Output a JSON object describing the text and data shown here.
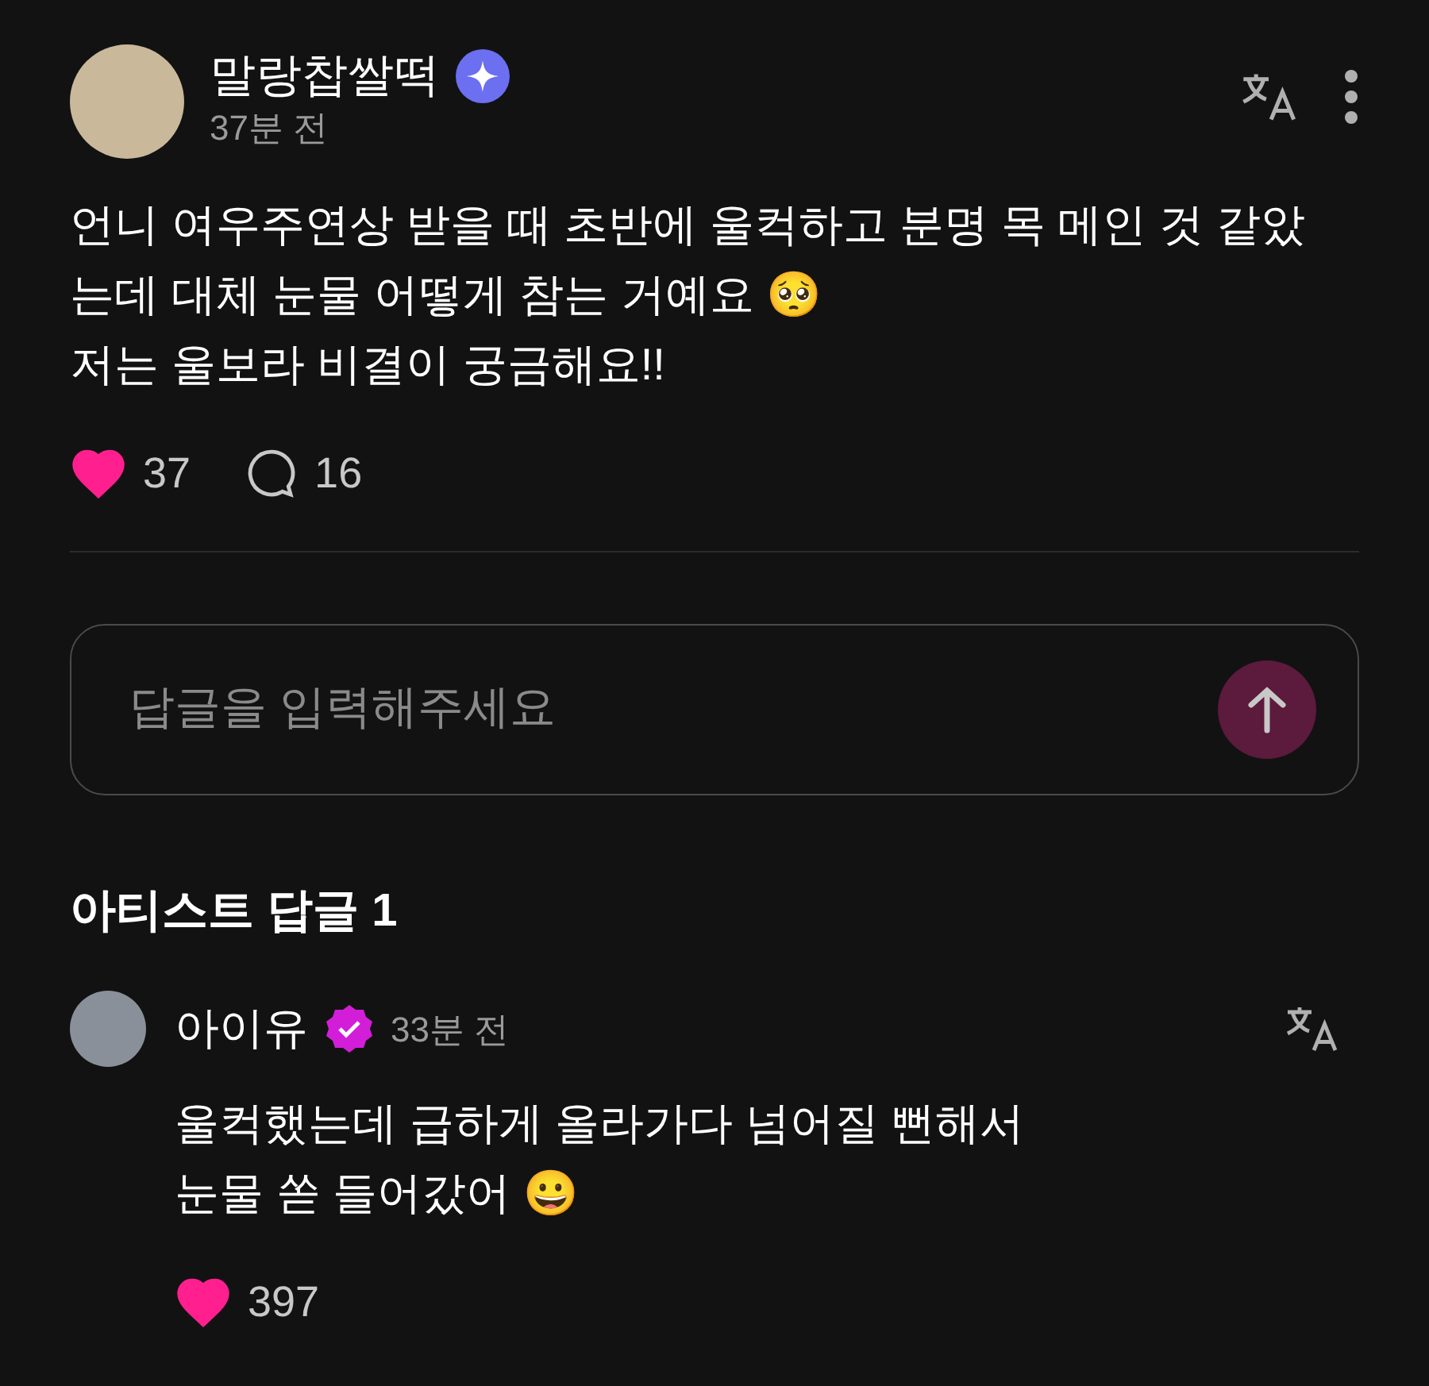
{
  "post": {
    "author": "말랑찹쌀떡",
    "time": "37분 전",
    "paragraphs": [
      "언니 여우주연상 받을 때 초반에 울컥하고 분명 목 메인 것 같았는데 대체 눈물 어떻게 참는 거예요 🥺",
      "저는 울보라 비결이 궁금해요!!"
    ],
    "likes": "37",
    "liked": true,
    "comments": "16"
  },
  "reply_input": {
    "placeholder": "답글을 입력해주세요"
  },
  "artist_replies": {
    "title": "아티스트 답글 1",
    "items": [
      {
        "author": "아이유",
        "time": "33분 전",
        "lines": [
          "울컥했는데 급하게 올라가다 넘어질 뻔해서",
          "눈물 쏟 들어갔어 😀"
        ],
        "likes": "397",
        "liked": true
      }
    ]
  }
}
